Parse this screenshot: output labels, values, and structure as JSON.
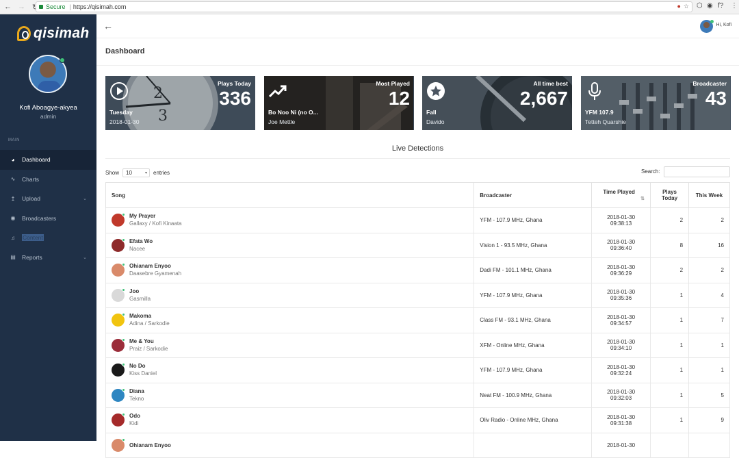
{
  "browser": {
    "secure_label": "Secure",
    "url": "https://qisimah.com"
  },
  "sidebar": {
    "logo_text": "qisimah",
    "user_name": "Kofi Aboagye-akyea",
    "user_role": "admin",
    "section_label": "MAIN",
    "items": [
      {
        "label": "Dashboard",
        "icon": "dashboard-icon",
        "active": true
      },
      {
        "label": "Charts",
        "icon": "pulse-icon"
      },
      {
        "label": "Upload",
        "icon": "upload-icon",
        "chevron": true
      },
      {
        "label": "Broadcasters",
        "icon": "broadcast-icon"
      },
      {
        "label": "Content",
        "icon": "music-note-icon",
        "highlighted": true
      },
      {
        "label": "Reports",
        "icon": "report-icon",
        "chevron": true
      }
    ]
  },
  "topbar": {
    "greeting": "Hi, Kofi"
  },
  "page": {
    "title": "Dashboard"
  },
  "cards": [
    {
      "label": "Plays Today",
      "value": "336",
      "sub1": "Tuesday",
      "sub2": "2018-01-30",
      "icon": "play-icon",
      "color": "#4a5866"
    },
    {
      "label": "Most Played",
      "value": "12",
      "sub1": "Bo Noo Ni (no O...",
      "sub2": "Joe Mettle",
      "icon": "trending-up-icon",
      "color": "#3a3632"
    },
    {
      "label": "All time best",
      "value": "2,667",
      "sub1": "Fall",
      "sub2": "Davido",
      "icon": "star-icon",
      "color": "#3d4652"
    },
    {
      "label": "Broadcaster",
      "value": "43",
      "sub1": "YFM 107.9",
      "sub2": "Tetteh Quarshie",
      "icon": "microphone-icon",
      "color": "#4b5764"
    }
  ],
  "live": {
    "title": "Live Detections",
    "show_label": "Show",
    "entries_value": "10",
    "entries_label": "entries",
    "search_label": "Search:",
    "columns": [
      "Song",
      "Broadcaster",
      "Time Played",
      "Plays Today",
      "This Week"
    ],
    "rows": [
      {
        "title": "My Prayer",
        "artist": "Gallaxy / Kofi Kinaata",
        "broadcaster": "YFM - 107.9 MHz, Ghana",
        "date": "2018-01-30",
        "time": "09:38:13",
        "today": "2",
        "week": "2",
        "thumb": "#c0392b"
      },
      {
        "title": "Efata Wo",
        "artist": "Nacee",
        "broadcaster": "Vision 1 - 93.5 MHz, Ghana",
        "date": "2018-01-30",
        "time": "09:36:40",
        "today": "8",
        "week": "16",
        "thumb": "#8e2a2a"
      },
      {
        "title": "Ohianam Enyoo",
        "artist": "Daasebre Gyamenah",
        "broadcaster": "Dadi FM - 101.1 MHz, Ghana",
        "date": "2018-01-30",
        "time": "09:36:29",
        "today": "2",
        "week": "2",
        "thumb": "#d98a6a"
      },
      {
        "title": "Joo",
        "artist": "Gasmilla",
        "broadcaster": "YFM - 107.9 MHz, Ghana",
        "date": "2018-01-30",
        "time": "09:35:36",
        "today": "1",
        "week": "4",
        "thumb": "#d9d9d9"
      },
      {
        "title": "Makoma",
        "artist": "Adina / Sarkodie",
        "broadcaster": "Class FM - 93.1 MHz, Ghana",
        "date": "2018-01-30",
        "time": "09:34:57",
        "today": "1",
        "week": "7",
        "thumb": "#f1c40f"
      },
      {
        "title": "Me & You",
        "artist": "Praiz / Sarkodie",
        "broadcaster": "XFM - Online MHz, Ghana",
        "date": "2018-01-30",
        "time": "09:34:10",
        "today": "1",
        "week": "1",
        "thumb": "#9b2d3a"
      },
      {
        "title": "No Do",
        "artist": "Kiss Daniel",
        "broadcaster": "YFM - 107.9 MHz, Ghana",
        "date": "2018-01-30",
        "time": "09:32:24",
        "today": "1",
        "week": "1",
        "thumb": "#1a1a1a"
      },
      {
        "title": "Diana",
        "artist": "Tekno",
        "broadcaster": "Neat FM - 100.9 MHz, Ghana",
        "date": "2018-01-30",
        "time": "09:32:03",
        "today": "1",
        "week": "5",
        "thumb": "#2e86c1"
      },
      {
        "title": "Odo",
        "artist": "Kidi",
        "broadcaster": "Oliv Radio - Online MHz, Ghana",
        "date": "2018-01-30",
        "time": "09:31:38",
        "today": "1",
        "week": "9",
        "thumb": "#a52a2a"
      },
      {
        "title": "Ohianam Enyoo",
        "artist": "",
        "broadcaster": "",
        "date": "2018-01-30",
        "time": "",
        "today": "",
        "week": "",
        "thumb": "#d98a6a"
      }
    ]
  }
}
